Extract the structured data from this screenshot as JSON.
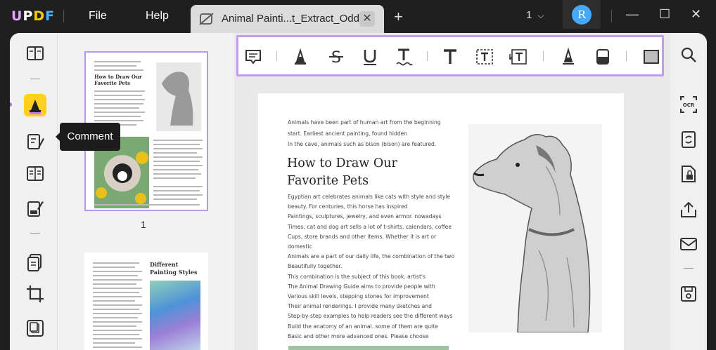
{
  "app": {
    "logo": {
      "u": "U",
      "p": "P",
      "d": "D",
      "f": "F"
    },
    "menu": {
      "file": "File",
      "help": "Help"
    },
    "tab": {
      "title": "Animal Painti...t_Extract_Odd",
      "close": "✕"
    },
    "new_tab": "+",
    "page_count": "1",
    "avatar_initial": "R",
    "window": {
      "minimize": "—",
      "maximize": "☐",
      "close": "✕"
    }
  },
  "tooltip": {
    "label": "Comment"
  },
  "thumbnails": {
    "page1_number": "1",
    "page1_heading": "How to Draw Our Favorite Pets",
    "page2_heading": "Different Painting Styles"
  },
  "document": {
    "intro_lines": [
      "Animals have been part of human art from the beginning",
      "start. Earliest ancient painting, found hidden",
      "In the cave, animals such as bison (bison) are featured."
    ],
    "heading_lines": [
      "How to Draw Our",
      "Favorite Pets"
    ],
    "body_lines": [
      "Egyptian art celebrates animals like cats with style and style",
      "beauty. For centuries, this horse has inspired",
      "Paintings, sculptures, jewelry, and even armor. nowadays",
      "Times, cat and dog art sells a lot of t-shirts, calendars, coffee",
      "Cups, store brands and other items. Whether it is art or domestic",
      "Animals are a part of our daily life, the combination of the two",
      "Beautifully together.",
      "This combination is the subject of this book. artist's",
      "The Animal Drawing Guide aims to provide people with",
      "Various skill levels, stepping stones for improvement",
      "Their animal renderings. I provide many sketches and",
      "Step-by-step examples to help readers see the different ways",
      "Build the anatomy of an animal. some of them are quite",
      "Basic and other more advanced ones. Please choose"
    ]
  },
  "colors": {
    "accent": "#c39cf0",
    "comment_highlight": "#ffcf1f",
    "avatar": "#47a9f5"
  },
  "icons": {
    "left": [
      "reader-icon",
      "comment-icon",
      "edit-pdf-icon",
      "form-icon",
      "redact-icon",
      "organize-icon",
      "crop-icon",
      "page-tools-icon"
    ],
    "toolbar": [
      "note-icon",
      "highlight-icon",
      "strikethrough-icon",
      "underline-icon",
      "squiggly-icon",
      "text-icon",
      "textbox-icon",
      "text-callout-icon",
      "pencil-icon",
      "eraser-icon",
      "shape-icon"
    ],
    "right": [
      "search-icon",
      "ocr-icon",
      "convert-icon",
      "protect-icon",
      "share-icon",
      "email-icon",
      "save-icon"
    ]
  }
}
